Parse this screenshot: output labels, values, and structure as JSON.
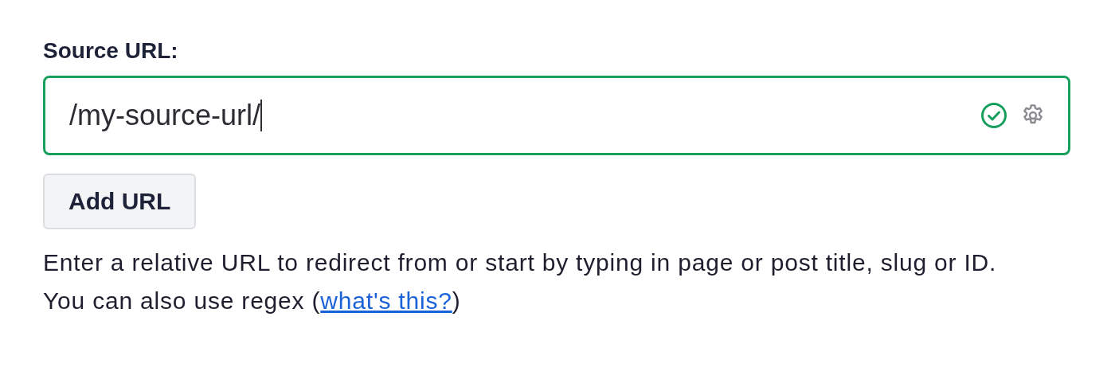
{
  "source_url": {
    "label": "Source URL:",
    "value": "/my-source-url/",
    "valid": true
  },
  "add_button": "Add URL",
  "help": {
    "text": "Enter a relative URL to redirect from or start by typing in page or post title, slug or ID. You can also use regex (",
    "link": "what's this?",
    "text_after": ")"
  }
}
